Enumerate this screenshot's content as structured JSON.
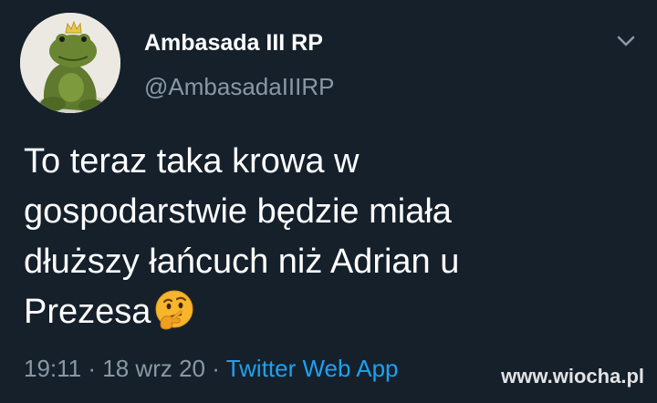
{
  "tweet": {
    "author": {
      "display_name": "Ambasada III RP",
      "handle": "@AmbasadaIIIRP",
      "avatar_icon": "frog-plush-with-crown"
    },
    "text_lines": [
      "To teraz taka krowa w",
      "gospodarstwie będzie miała",
      "dłuższy łańcuch niż Adrian u",
      "Prezesa"
    ],
    "emoji": "thinking-face-emoji",
    "time": "19:11",
    "separator": "·",
    "date": "18 wrz 20",
    "source": "Twitter Web App"
  },
  "menu_icon": "chevron-down-icon",
  "watermark": "www.wiocha.pl",
  "colors": {
    "background": "#15202b",
    "primary_text": "#ffffff",
    "secondary_text": "#8899a6",
    "link": "#1da1f2"
  }
}
